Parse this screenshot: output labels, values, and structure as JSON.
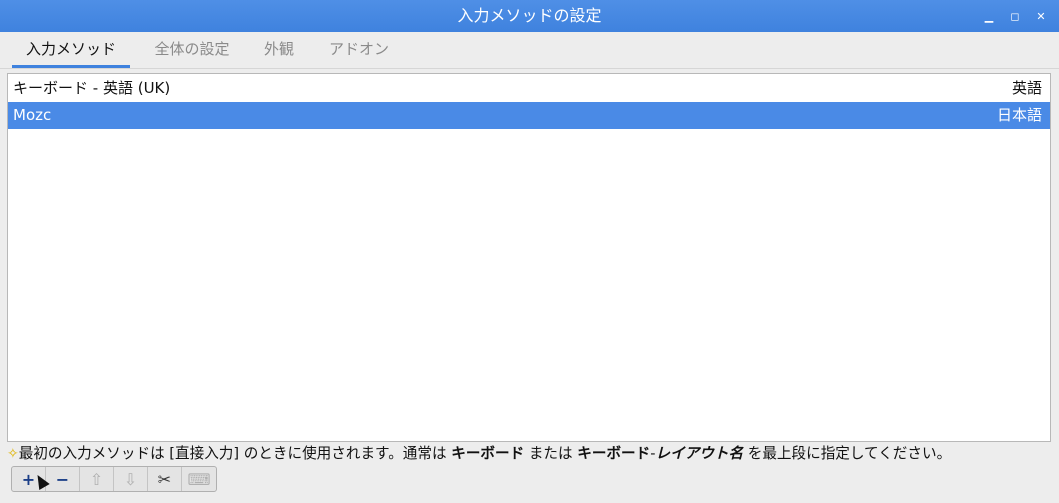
{
  "window": {
    "title": "入力メソッドの設定",
    "controls": [
      "minimize-icon",
      "maximize-icon",
      "close-icon"
    ]
  },
  "tabs": [
    {
      "label": "入力メソッド",
      "active": true
    },
    {
      "label": "全体の設定",
      "active": false
    },
    {
      "label": "外観",
      "active": false
    },
    {
      "label": "アドオン",
      "active": false
    }
  ],
  "input_methods": [
    {
      "name": "キーボード - 英語 (UK)",
      "language": "英語",
      "selected": false
    },
    {
      "name": "Mozc",
      "language": "日本語",
      "selected": true
    }
  ],
  "hint": {
    "icon": "star-icon",
    "part1": "最初の入力メソッドは [直接入力] のときに使用されます。通常は ",
    "bold1": "キーボード",
    "part2": " または ",
    "bold2": "キーボード",
    "dash": "-",
    "italic": "レイアウト名",
    "part3": " を最上段に指定してください。"
  },
  "toolbar": {
    "add_symbol": "+",
    "remove_symbol": "−",
    "up_symbol": "⇧",
    "down_symbol": "⇩",
    "configure_symbol": "✂",
    "keyboard_symbol": "⌨"
  },
  "colors": {
    "titlebar": "#3f82de",
    "selection": "#4a8ae6",
    "tab_indicator": "#3f82de"
  }
}
